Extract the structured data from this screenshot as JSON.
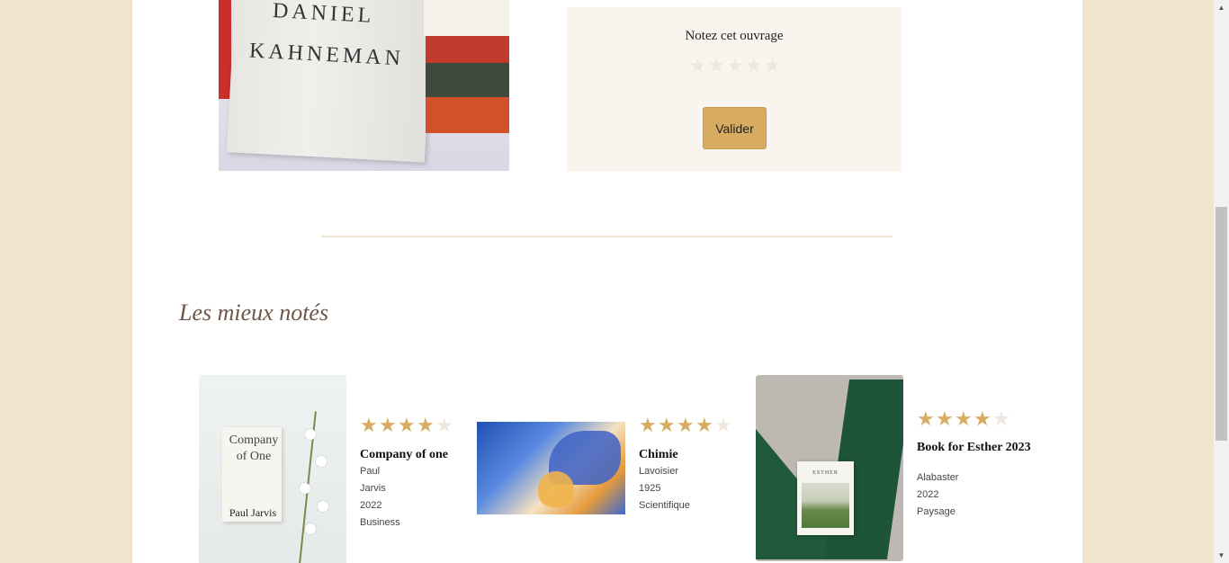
{
  "featured": {
    "cover_author_line1": "DANIEL",
    "cover_author_line2": "KAHNEMAN"
  },
  "rating": {
    "title": "Notez cet ouvrage",
    "stars_max": 5,
    "stars_selected": 0,
    "submit_label": "Valider"
  },
  "best_rated": {
    "title": "Les mieux notés",
    "books": [
      {
        "title": "Company of one",
        "author": "Paul Jarvis",
        "year": "2022",
        "category": "Business",
        "rating": 4,
        "cover_text_title": "Company of One",
        "cover_text_author": "Paul Jarvis"
      },
      {
        "title": "Chimie",
        "author": "Lavoisier",
        "year": "1925",
        "category": "Scientifique",
        "rating": 4
      },
      {
        "title": "Book for Esther 2023",
        "author": "Alabaster",
        "year": "2022",
        "category": "Paysage",
        "rating": 4,
        "cover_text_title": "ESTHER"
      }
    ]
  },
  "colors": {
    "page_background": "#f1e4cf",
    "accent": "#d8ab62",
    "star_off": "#efe7de",
    "panel": "#faf4ee",
    "section_title": "#6e5648"
  },
  "icons": {
    "star": "star-icon",
    "scroll_up": "scroll-up-arrow-icon",
    "scroll_down": "scroll-down-arrow-icon"
  }
}
